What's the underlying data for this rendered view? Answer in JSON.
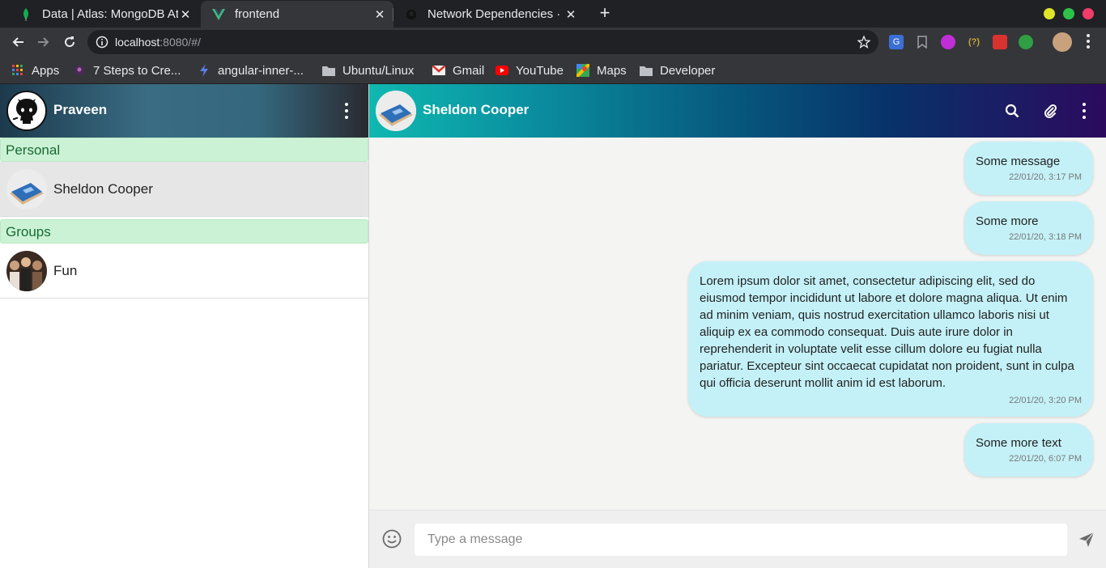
{
  "browser": {
    "tabs": [
      {
        "title": "Data | Atlas: MongoDB Atlas",
        "icon": "leaf-icon",
        "active": false
      },
      {
        "title": "frontend",
        "icon": "vue-icon",
        "active": true
      },
      {
        "title": "Network Dependencies · F",
        "icon": "github-icon",
        "active": false
      }
    ],
    "url_host": "localhost",
    "url_path": ":8080/#/",
    "bookmarks": [
      {
        "label": "Apps",
        "icon": "apps-grid-icon"
      },
      {
        "label": "7 Steps to Cre...",
        "icon": "bookmark-site-icon"
      },
      {
        "label": "angular-inner-...",
        "icon": "lightning-icon"
      },
      {
        "label": "Ubuntu/Linux",
        "icon": "folder-icon"
      },
      {
        "label": "Gmail",
        "icon": "gmail-icon"
      },
      {
        "label": "YouTube",
        "icon": "youtube-icon"
      },
      {
        "label": "Maps",
        "icon": "maps-icon"
      },
      {
        "label": "Developer",
        "icon": "folder-icon"
      }
    ],
    "colors": {
      "tabstrip": "#202124",
      "toolbar": "#35363a"
    }
  },
  "sidebar": {
    "user_name": "Praveen",
    "sections": [
      {
        "label": "Personal",
        "contacts": [
          {
            "name": "Sheldon Cooper",
            "selected": true
          }
        ]
      },
      {
        "label": "Groups",
        "contacts": [
          {
            "name": "Fun",
            "selected": false
          }
        ]
      }
    ]
  },
  "chat": {
    "contact_name": "Sheldon Cooper",
    "messages": [
      {
        "text": "Some message",
        "time": "22/01/20, 3:17 PM"
      },
      {
        "text": "Some more",
        "time": "22/01/20, 3:18 PM"
      },
      {
        "text": "Lorem ipsum dolor sit amet, consectetur adipiscing elit, sed do eiusmod tempor incididunt ut labore et dolore magna aliqua. Ut enim ad minim veniam, quis nostrud exercitation ullamco laboris nisi ut aliquip ex ea commodo consequat. Duis aute irure dolor in reprehenderit in voluptate velit esse cillum dolore eu fugiat nulla pariatur. Excepteur sint occaecat cupidatat non proident, sunt in culpa qui officia deserunt mollit anim id est laborum.",
        "time": "22/01/20, 3:20 PM"
      },
      {
        "text": "Some more text",
        "time": "22/01/20, 6:07 PM"
      }
    ],
    "composer": {
      "placeholder": "Type a message",
      "value": ""
    },
    "colors": {
      "bubble": "#c4f1f7",
      "section_bg": "#ccf2d6",
      "section_text": "#176b32"
    }
  }
}
